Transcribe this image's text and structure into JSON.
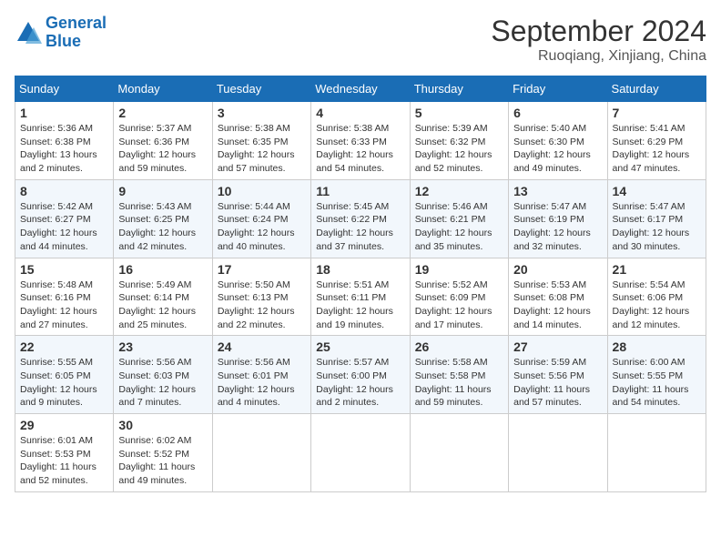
{
  "logo": {
    "line1": "General",
    "line2": "Blue"
  },
  "title": "September 2024",
  "subtitle": "Ruoqiang, Xinjiang, China",
  "days_of_week": [
    "Sunday",
    "Monday",
    "Tuesday",
    "Wednesday",
    "Thursday",
    "Friday",
    "Saturday"
  ],
  "weeks": [
    [
      {
        "day": "1",
        "info": "Sunrise: 5:36 AM\nSunset: 6:38 PM\nDaylight: 13 hours\nand 2 minutes."
      },
      {
        "day": "2",
        "info": "Sunrise: 5:37 AM\nSunset: 6:36 PM\nDaylight: 12 hours\nand 59 minutes."
      },
      {
        "day": "3",
        "info": "Sunrise: 5:38 AM\nSunset: 6:35 PM\nDaylight: 12 hours\nand 57 minutes."
      },
      {
        "day": "4",
        "info": "Sunrise: 5:38 AM\nSunset: 6:33 PM\nDaylight: 12 hours\nand 54 minutes."
      },
      {
        "day": "5",
        "info": "Sunrise: 5:39 AM\nSunset: 6:32 PM\nDaylight: 12 hours\nand 52 minutes."
      },
      {
        "day": "6",
        "info": "Sunrise: 5:40 AM\nSunset: 6:30 PM\nDaylight: 12 hours\nand 49 minutes."
      },
      {
        "day": "7",
        "info": "Sunrise: 5:41 AM\nSunset: 6:29 PM\nDaylight: 12 hours\nand 47 minutes."
      }
    ],
    [
      {
        "day": "8",
        "info": "Sunrise: 5:42 AM\nSunset: 6:27 PM\nDaylight: 12 hours\nand 44 minutes."
      },
      {
        "day": "9",
        "info": "Sunrise: 5:43 AM\nSunset: 6:25 PM\nDaylight: 12 hours\nand 42 minutes."
      },
      {
        "day": "10",
        "info": "Sunrise: 5:44 AM\nSunset: 6:24 PM\nDaylight: 12 hours\nand 40 minutes."
      },
      {
        "day": "11",
        "info": "Sunrise: 5:45 AM\nSunset: 6:22 PM\nDaylight: 12 hours\nand 37 minutes."
      },
      {
        "day": "12",
        "info": "Sunrise: 5:46 AM\nSunset: 6:21 PM\nDaylight: 12 hours\nand 35 minutes."
      },
      {
        "day": "13",
        "info": "Sunrise: 5:47 AM\nSunset: 6:19 PM\nDaylight: 12 hours\nand 32 minutes."
      },
      {
        "day": "14",
        "info": "Sunrise: 5:47 AM\nSunset: 6:17 PM\nDaylight: 12 hours\nand 30 minutes."
      }
    ],
    [
      {
        "day": "15",
        "info": "Sunrise: 5:48 AM\nSunset: 6:16 PM\nDaylight: 12 hours\nand 27 minutes."
      },
      {
        "day": "16",
        "info": "Sunrise: 5:49 AM\nSunset: 6:14 PM\nDaylight: 12 hours\nand 25 minutes."
      },
      {
        "day": "17",
        "info": "Sunrise: 5:50 AM\nSunset: 6:13 PM\nDaylight: 12 hours\nand 22 minutes."
      },
      {
        "day": "18",
        "info": "Sunrise: 5:51 AM\nSunset: 6:11 PM\nDaylight: 12 hours\nand 19 minutes."
      },
      {
        "day": "19",
        "info": "Sunrise: 5:52 AM\nSunset: 6:09 PM\nDaylight: 12 hours\nand 17 minutes."
      },
      {
        "day": "20",
        "info": "Sunrise: 5:53 AM\nSunset: 6:08 PM\nDaylight: 12 hours\nand 14 minutes."
      },
      {
        "day": "21",
        "info": "Sunrise: 5:54 AM\nSunset: 6:06 PM\nDaylight: 12 hours\nand 12 minutes."
      }
    ],
    [
      {
        "day": "22",
        "info": "Sunrise: 5:55 AM\nSunset: 6:05 PM\nDaylight: 12 hours\nand 9 minutes."
      },
      {
        "day": "23",
        "info": "Sunrise: 5:56 AM\nSunset: 6:03 PM\nDaylight: 12 hours\nand 7 minutes."
      },
      {
        "day": "24",
        "info": "Sunrise: 5:56 AM\nSunset: 6:01 PM\nDaylight: 12 hours\nand 4 minutes."
      },
      {
        "day": "25",
        "info": "Sunrise: 5:57 AM\nSunset: 6:00 PM\nDaylight: 12 hours\nand 2 minutes."
      },
      {
        "day": "26",
        "info": "Sunrise: 5:58 AM\nSunset: 5:58 PM\nDaylight: 11 hours\nand 59 minutes."
      },
      {
        "day": "27",
        "info": "Sunrise: 5:59 AM\nSunset: 5:56 PM\nDaylight: 11 hours\nand 57 minutes."
      },
      {
        "day": "28",
        "info": "Sunrise: 6:00 AM\nSunset: 5:55 PM\nDaylight: 11 hours\nand 54 minutes."
      }
    ],
    [
      {
        "day": "29",
        "info": "Sunrise: 6:01 AM\nSunset: 5:53 PM\nDaylight: 11 hours\nand 52 minutes."
      },
      {
        "day": "30",
        "info": "Sunrise: 6:02 AM\nSunset: 5:52 PM\nDaylight: 11 hours\nand 49 minutes."
      },
      {
        "day": "",
        "info": ""
      },
      {
        "day": "",
        "info": ""
      },
      {
        "day": "",
        "info": ""
      },
      {
        "day": "",
        "info": ""
      },
      {
        "day": "",
        "info": ""
      }
    ]
  ]
}
